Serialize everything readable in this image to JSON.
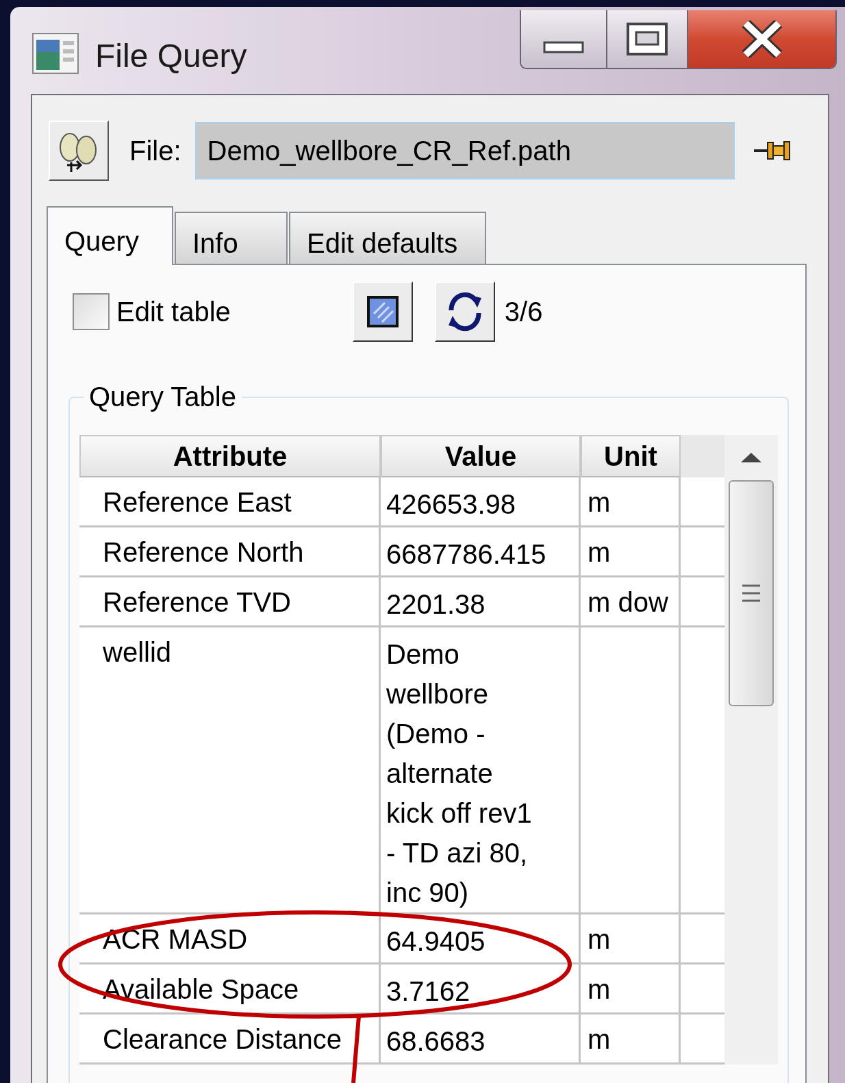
{
  "window": {
    "title": "File Query"
  },
  "file": {
    "label": "File:",
    "value": "Demo_wellbore_CR_Ref.path"
  },
  "tabs": [
    {
      "label": "Query",
      "selected": true
    },
    {
      "label": "Info",
      "selected": false
    },
    {
      "label": "Edit defaults",
      "selected": false
    }
  ],
  "edit_table": {
    "label": "Edit table",
    "checked": false
  },
  "counter": "3/6",
  "query_table": {
    "title": "Query Table",
    "columns": [
      "Attribute",
      "Value",
      "Unit"
    ],
    "rows": [
      {
        "attribute": "Reference East",
        "value": "426653.98",
        "unit": "m"
      },
      {
        "attribute": "Reference North",
        "value": "6687786.415",
        "unit": "m"
      },
      {
        "attribute": "Reference TVD",
        "value": "2201.38",
        "unit": "m dow"
      },
      {
        "attribute": "wellid",
        "value": "Demo wellbore (Demo - alternate kick off rev1 - TD azi 80, inc 90)"
      },
      {
        "attribute": "ACR MASD",
        "value": "64.9405",
        "unit": "m"
      },
      {
        "attribute": "Available Space",
        "value": "3.7162",
        "unit": "m"
      },
      {
        "attribute": "Clearance Distance",
        "value": "68.6683",
        "unit": "m"
      }
    ]
  }
}
